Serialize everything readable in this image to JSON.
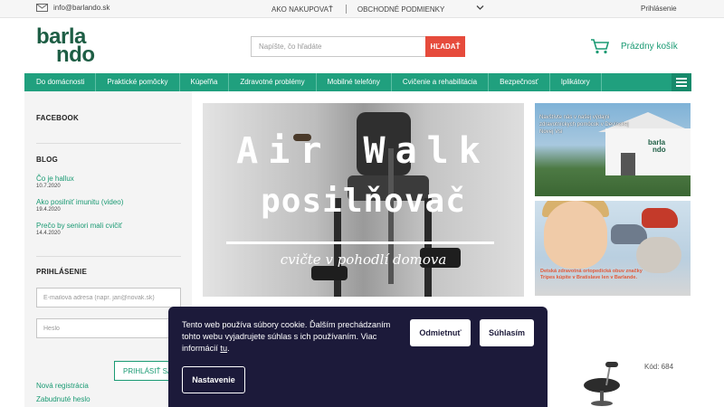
{
  "topbar": {
    "email": "info@barlando.sk",
    "how_to_buy": "AKO NAKUPOVAŤ",
    "terms": "OBCHODNÉ PODMIENKY",
    "login": "Prihlásenie"
  },
  "header": {
    "logo_line1": "barla",
    "logo_line2": "ndo",
    "search_placeholder": "Napíšte, čo hľadáte",
    "search_button": "HĽADAŤ",
    "cart_label": "Prázdny košík"
  },
  "nav": {
    "items": [
      "Do domácnosti",
      "Praktické pomôcky",
      "Kúpeľňa",
      "Zdravotné problémy",
      "Mobilné telefóny",
      "Cvičenie a rehabilitácia",
      "Bezpečnosť",
      "Iplikátory"
    ]
  },
  "sidebar": {
    "facebook_title": "FACEBOOK",
    "blog_title": "BLOG",
    "blog_posts": [
      {
        "title": "Čo je hallux",
        "date": "10.7.2020"
      },
      {
        "title": "Ako posilniť imunitu (video)",
        "date": "19.4.2020"
      },
      {
        "title": "Prečo by seniori mali cvičiť",
        "date": "14.4.2020"
      }
    ],
    "login_title": "PRIHLÁSENIE",
    "email_placeholder": "E-mailová adresa (napr. jan@novak.sk)",
    "password_placeholder": "Heslo",
    "login_button": "PRIHLÁSIŤ SA",
    "register_link": "Nová registrácia",
    "forgot_link": "Zabudnuté heslo"
  },
  "banner": {
    "title_line1": "Air Walk",
    "title_line2": "posilňovač",
    "subtitle": "cvičte v pohodlí domova"
  },
  "side_banners": {
    "top_caption": "Navštívte nás v našej výdajni zdravotníckych pomôcok v Devínskej Novej Vsi",
    "top_logo_line1": "barla",
    "top_logo_line2": "ndo",
    "bottom_caption": "Detská zdravotná ortopedická obuv značky Tripes kúpite v Bratislave len v Barlande."
  },
  "product": {
    "code": "Kód: 684"
  },
  "cookie": {
    "text_before": "Tento web používa súbory cookie. Ďalším prechádzaním tohto webu vyjadrujete súhlas s ich používaním. Viac informácií ",
    "link": "tu",
    "text_after": ".",
    "decline": "Odmietnuť",
    "accept": "Súhlasím",
    "settings": "Nastavenie"
  },
  "colors": {
    "brand_green": "#20a07e",
    "logo_green": "#1e5e45",
    "search_red": "#e64b3c",
    "cookie_bg": "#1c1a3a"
  }
}
